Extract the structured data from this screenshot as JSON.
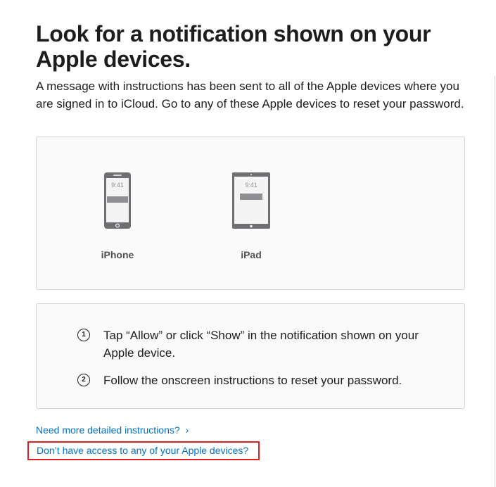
{
  "heading": "Look for a notification shown on your Apple devices.",
  "intro": "A message with instructions has been sent to all of the Apple devices where you are signed in to iCloud. Go to any of these Apple devices to reset your password.",
  "devices": [
    {
      "name": "iPhone",
      "time": "9:41",
      "icon": "iphone-icon"
    },
    {
      "name": "iPad",
      "time": "9:41",
      "icon": "ipad-icon"
    }
  ],
  "steps": [
    {
      "number": "1",
      "text": "Tap “Allow” or click “Show” in the notification shown on your Apple device."
    },
    {
      "number": "2",
      "text": "Follow the onscreen instructions to reset your password."
    }
  ],
  "links": {
    "detailed": "Need more detailed instructions?",
    "detailed_chevron": "›",
    "no_access": "Don’t have access to any of your Apple devices?"
  },
  "colors": {
    "link": "#0070c9",
    "highlight_border": "#e02020",
    "device_gray": "#6e6e73"
  }
}
